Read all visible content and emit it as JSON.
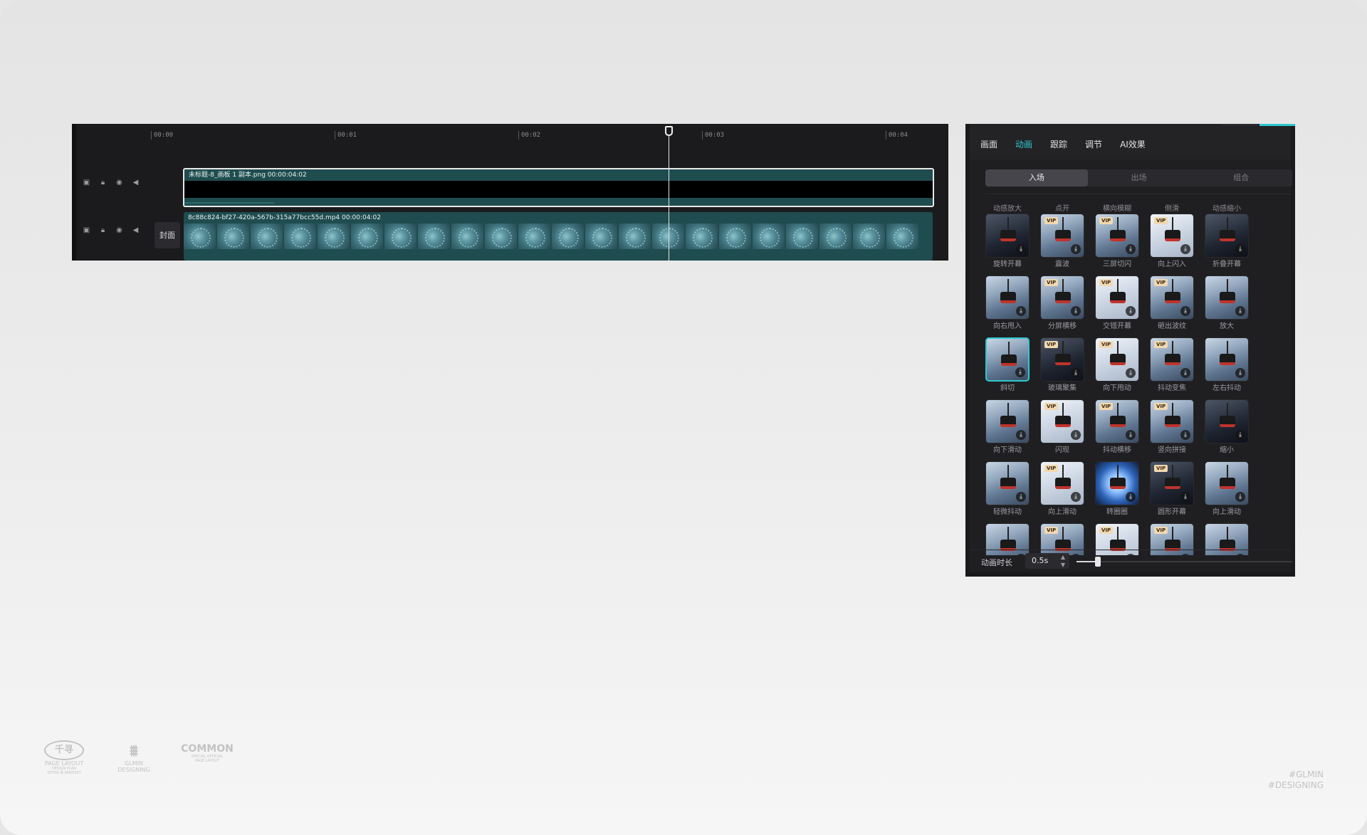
{
  "timeline": {
    "ruler": [
      "00:00",
      "00:01",
      "00:02",
      "00:03",
      "00:04"
    ],
    "track_controls": [
      "cover-toggle",
      "lock",
      "eye",
      "volume"
    ],
    "cover_button": "封面",
    "clip1": {
      "label": "未标题-8_画板 1 副本.png   00:00:04:02",
      "progress": 0.12
    },
    "clip2": {
      "label": "8c88c824-bf27-420a-567b-315a77bcc55d.mp4   00:00:04:02"
    },
    "playhead_time_fraction": 0.665
  },
  "panel": {
    "tabs": [
      "画面",
      "动画",
      "跟踪",
      "调节",
      "AI效果"
    ],
    "active_tab": 1,
    "sub_tabs": [
      "入场",
      "出场",
      "组合"
    ],
    "active_sub_tab": 0,
    "top_labels": [
      "动感放大",
      "点开",
      "横向模糊",
      "侧滑",
      "动感缩小"
    ],
    "vip_text": "VIP",
    "items": [
      {
        "label": "旋转开幕",
        "vip": false,
        "style": "dark"
      },
      {
        "label": "震波",
        "vip": true,
        "style": "snow"
      },
      {
        "label": "三屏切闪",
        "vip": true,
        "style": "snow"
      },
      {
        "label": "向上闪入",
        "vip": true,
        "style": "light"
      },
      {
        "label": "折叠开幕",
        "vip": false,
        "style": "dark"
      },
      {
        "label": "向右甩入",
        "vip": false,
        "style": "snow"
      },
      {
        "label": "分屏横移",
        "vip": true,
        "style": "snow"
      },
      {
        "label": "交错开幕",
        "vip": true,
        "style": "light"
      },
      {
        "label": "砸出波纹",
        "vip": true,
        "style": "snow"
      },
      {
        "label": "放大",
        "vip": false,
        "style": "snow"
      },
      {
        "label": "斜切",
        "vip": false,
        "style": "snow",
        "selected": true
      },
      {
        "label": "玻璃聚集",
        "vip": true,
        "style": "dark"
      },
      {
        "label": "向下甩动",
        "vip": true,
        "style": "light"
      },
      {
        "label": "抖动变焦",
        "vip": true,
        "style": "snow"
      },
      {
        "label": "左右抖动",
        "vip": false,
        "style": "snow"
      },
      {
        "label": "向下滑动",
        "vip": false,
        "style": "snow"
      },
      {
        "label": "闪现",
        "vip": true,
        "style": "light"
      },
      {
        "label": "抖动横移",
        "vip": true,
        "style": "snow"
      },
      {
        "label": "竖向拼接",
        "vip": true,
        "style": "snow"
      },
      {
        "label": "缩小",
        "vip": false,
        "style": "dark"
      },
      {
        "label": "轻微抖动",
        "vip": false,
        "style": "snow"
      },
      {
        "label": "向上滑动",
        "vip": true,
        "style": "light"
      },
      {
        "label": "转圈圈",
        "vip": false,
        "style": "blue"
      },
      {
        "label": "圆形开幕",
        "vip": true,
        "style": "dark"
      },
      {
        "label": "向上滑动",
        "vip": false,
        "style": "snow"
      },
      {
        "label": "",
        "vip": false,
        "style": "snow"
      },
      {
        "label": "",
        "vip": true,
        "style": "snow"
      },
      {
        "label": "",
        "vip": true,
        "style": "light"
      },
      {
        "label": "",
        "vip": true,
        "style": "snow"
      },
      {
        "label": "",
        "vip": false,
        "style": "snow"
      }
    ],
    "duration_label": "动画时长",
    "duration_value": "0.5s",
    "duration_fraction": 0.1,
    "accent_color": "#2fc8cf"
  },
  "footer": {
    "logo1": {
      "badge": "千寻",
      "line1": "PAGE LAYOUT",
      "line2": "DESIGN PLAN",
      "line3": "OFFER 贡·MINDSET"
    },
    "logo2": {
      "mark": "⩩",
      "line1": "GLMIN",
      "line2": "DESIGNING"
    },
    "logo3": {
      "mark": "COMMON",
      "line1": "SPECIAL OFFICIAL",
      "line2": "PAGE LAYOUT"
    },
    "tags": [
      "#GLMIN",
      "#DESIGNING"
    ]
  }
}
